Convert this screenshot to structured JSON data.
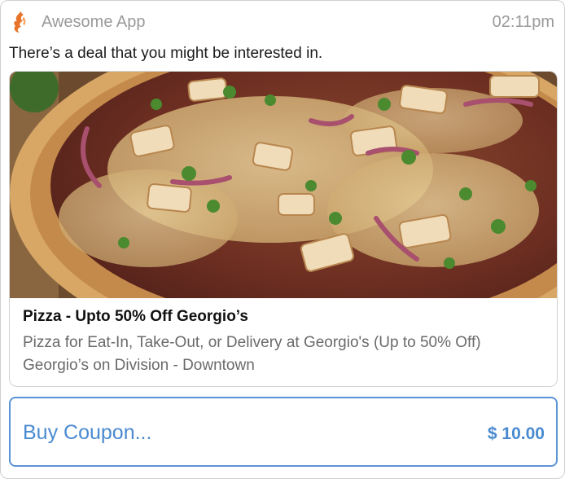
{
  "header": {
    "app_icon": "flame-icon",
    "app_name": "Awesome App",
    "time": "02:11pm"
  },
  "message": "There’s a deal that you might be interested in.",
  "deal": {
    "image": "pizza-photo",
    "title": "Pizza - Upto 50% Off Georgio’s",
    "description": "Pizza for Eat-In, Take-Out, or Delivery at Georgio's (Up to 50% Off)",
    "location": "Georgio’s on Division - Downtown"
  },
  "action": {
    "label": "Buy Coupon...",
    "price": "$ 10.00"
  },
  "colors": {
    "accent": "#4a8ad0",
    "button_border": "#5b94d6",
    "muted_text": "#9a9a9a",
    "flame": "#e8742a"
  }
}
